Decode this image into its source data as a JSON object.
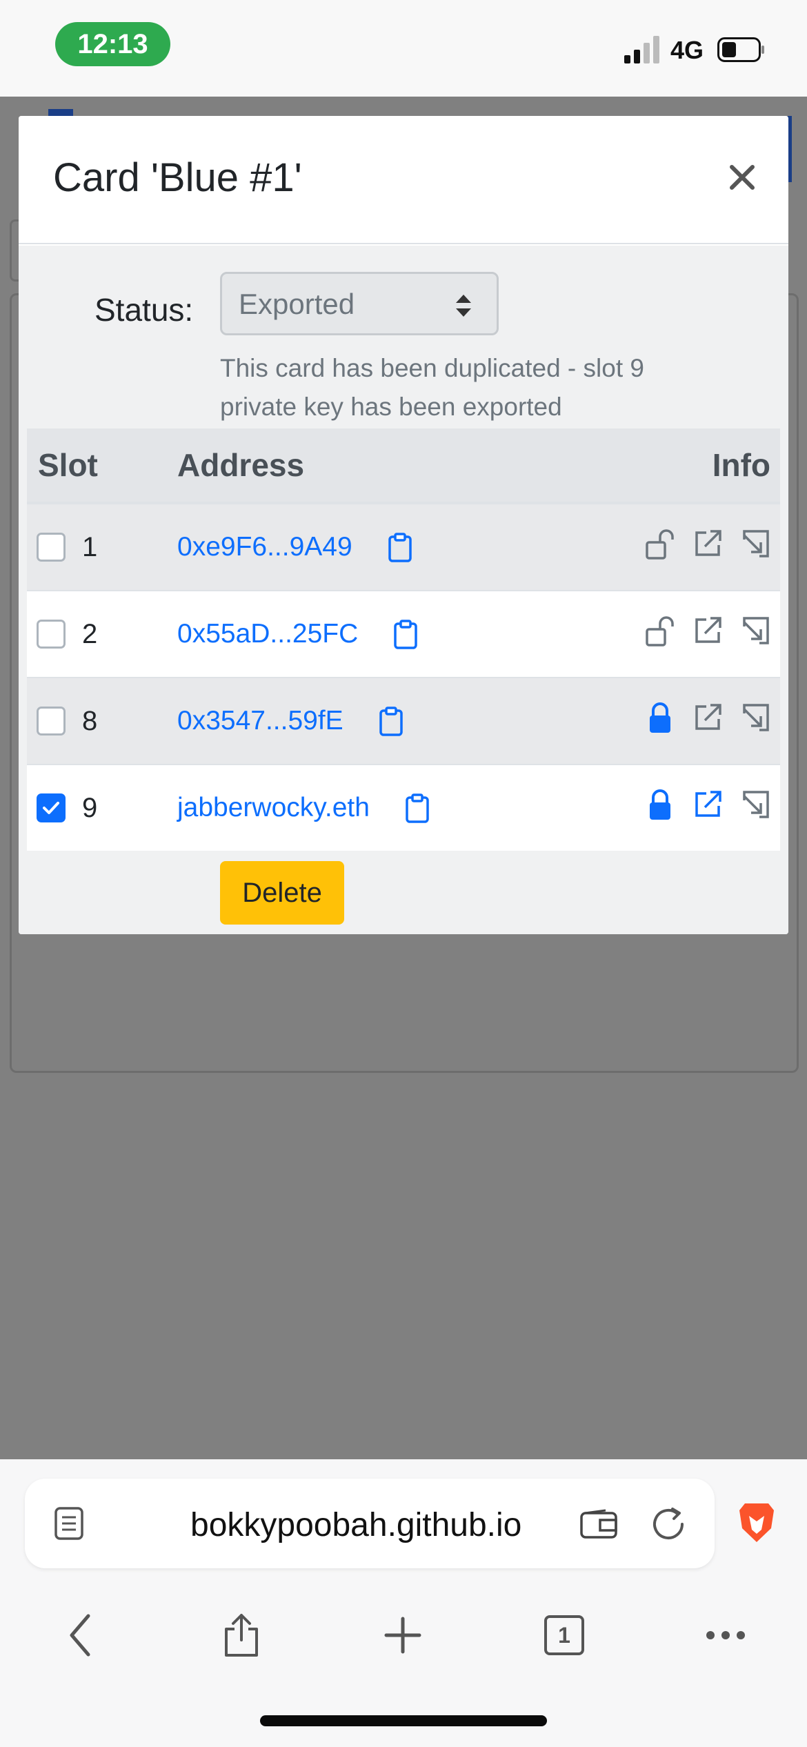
{
  "status_bar": {
    "time": "12:13",
    "network": "4G"
  },
  "modal": {
    "title": "Card 'Blue #1'",
    "status": {
      "label": "Status:",
      "selected": "Exported",
      "help": "This card has been duplicated - slot 9 private key has been exported"
    },
    "table": {
      "headers": {
        "slot": "Slot",
        "address": "Address",
        "info": "Info"
      },
      "rows": [
        {
          "checked": false,
          "slot": "1",
          "address": "0xe9F6...9A49",
          "locked": false
        },
        {
          "checked": false,
          "slot": "2",
          "address": "0x55aD...25FC",
          "locked": false
        },
        {
          "checked": false,
          "slot": "8",
          "address": "0x3547...59fE",
          "locked": true
        },
        {
          "checked": true,
          "slot": "9",
          "address": "jabberwocky.eth",
          "locked": true
        }
      ]
    },
    "delete_label": "Delete"
  },
  "browser": {
    "url": "bokkypoobah.github.io",
    "tab_count": "1"
  },
  "colors": {
    "primary": "#0d6efd",
    "warning": "#ffc107",
    "time_pill": "#2eaa4f",
    "muted_icon": "#6c757d",
    "brave": "#fb542b"
  }
}
